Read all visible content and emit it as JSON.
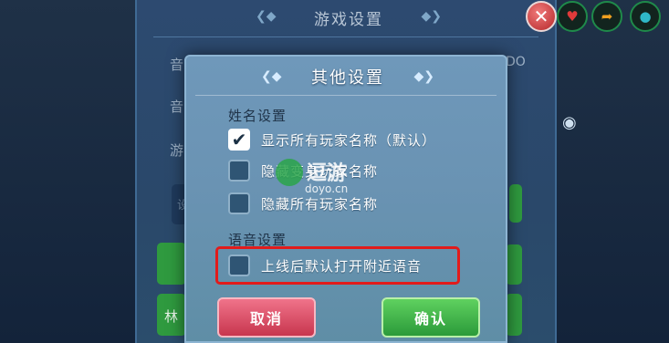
{
  "background_panel": {
    "title": "游戏设置",
    "row_label_1": "音",
    "row_label_2": "音",
    "row_label_3": "游",
    "stray_text_right": "DO",
    "stray_text_left": "设",
    "bottom_left_label": "林"
  },
  "dialog": {
    "title": "其他设置",
    "name_section": {
      "title": "姓名设置",
      "options": [
        {
          "label": "显示所有玩家名称（默认）",
          "checked": true
        },
        {
          "label": "隐藏变身玩家名称",
          "checked": false
        },
        {
          "label": "隐藏所有玩家名称",
          "checked": false
        }
      ]
    },
    "voice_section": {
      "title": "语音设置",
      "options": [
        {
          "label": "上线后默认打开附近语音",
          "checked": false
        }
      ]
    },
    "cancel_label": "取消",
    "confirm_label": "确认"
  },
  "watermark": {
    "text": "逗游",
    "url": "doyo.cn"
  },
  "colors": {
    "highlight": "#e21b1b",
    "cancel": "#d84a62",
    "confirm": "#3cb34a"
  }
}
